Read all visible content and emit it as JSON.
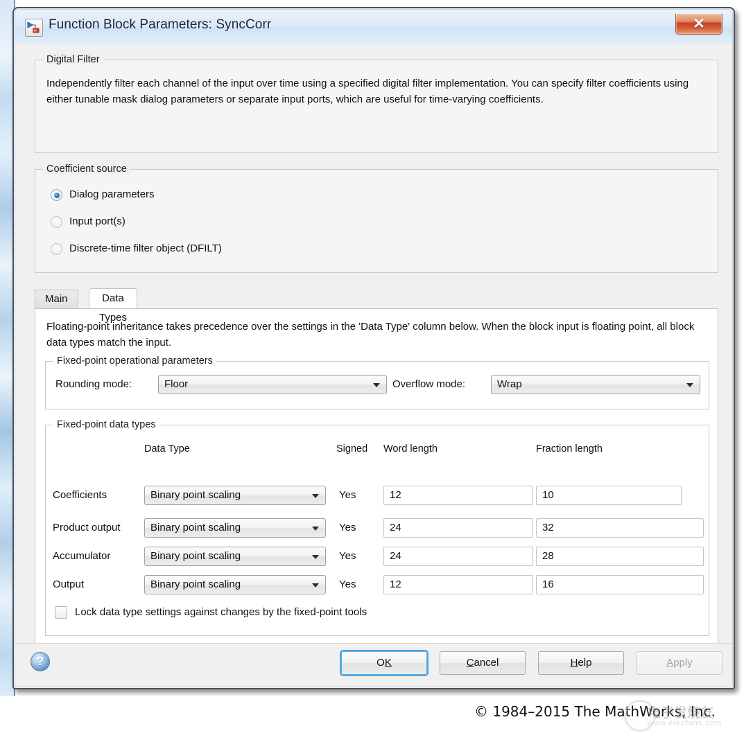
{
  "window": {
    "title": "Function Block Parameters: SyncCorr",
    "icon": "simulink-block-icon",
    "close_label": "✕"
  },
  "description_group": {
    "legend": "Digital Filter",
    "text": "Independently filter each channel of the input over time using a specified digital filter implementation. You can specify filter coefficients using either tunable mask dialog parameters or separate input ports, which are useful for time-varying coefficients."
  },
  "coefficient_source": {
    "legend": "Coefficient source",
    "options": [
      {
        "label": "Dialog parameters",
        "selected": true
      },
      {
        "label": "Input port(s)",
        "selected": false
      },
      {
        "label": "Discrete-time filter object (DFILT)",
        "selected": false
      }
    ]
  },
  "tabs": [
    {
      "label": "Main",
      "active": false
    },
    {
      "label": "Data Types",
      "active": true
    }
  ],
  "data_types_panel": {
    "note": "Floating-point inheritance takes precedence over the settings in the 'Data Type' column below. When the block input is floating point, all block data types match the input.",
    "operational": {
      "legend": "Fixed-point operational parameters",
      "rounding_label": "Rounding mode:",
      "rounding_value": "Floor",
      "overflow_label": "Overflow mode:",
      "overflow_value": "Wrap"
    },
    "fixed_point": {
      "legend": "Fixed-point data types",
      "headers": {
        "data_type": "Data Type",
        "signed": "Signed",
        "word_length": "Word length",
        "fraction_length": "Fraction length"
      },
      "rows": [
        {
          "name": "Coefficients",
          "data_type": "Binary point scaling",
          "signed": "Yes",
          "word_length": "12",
          "fraction_length": "10"
        },
        {
          "name": "Product output",
          "data_type": "Binary point scaling",
          "signed": "Yes",
          "word_length": "24",
          "fraction_length": "32"
        },
        {
          "name": "Accumulator",
          "data_type": "Binary point scaling",
          "signed": "Yes",
          "word_length": "24",
          "fraction_length": "28"
        },
        {
          "name": "Output",
          "data_type": "Binary point scaling",
          "signed": "Yes",
          "word_length": "12",
          "fraction_length": "16"
        }
      ],
      "lock_checkbox": {
        "label": "Lock data type settings against changes by the fixed-point tools",
        "checked": false
      }
    }
  },
  "buttons": {
    "help_icon": "?",
    "ok": {
      "pre": "O",
      "mnemonic": "K",
      "post": "",
      "focused": true,
      "enabled": true
    },
    "cancel": {
      "pre": "",
      "mnemonic": "C",
      "post": "ancel",
      "focused": false,
      "enabled": true
    },
    "help": {
      "pre": "",
      "mnemonic": "H",
      "post": "elp",
      "focused": false,
      "enabled": true
    },
    "apply": {
      "pre": "",
      "mnemonic": "A",
      "post": "pply",
      "focused": false,
      "enabled": false
    }
  },
  "footer": {
    "copyright": "© 1984–2015 The MathWorks, Inc.",
    "watermark_title": "电子发烧友",
    "watermark_url": "www.elecfans.com"
  }
}
